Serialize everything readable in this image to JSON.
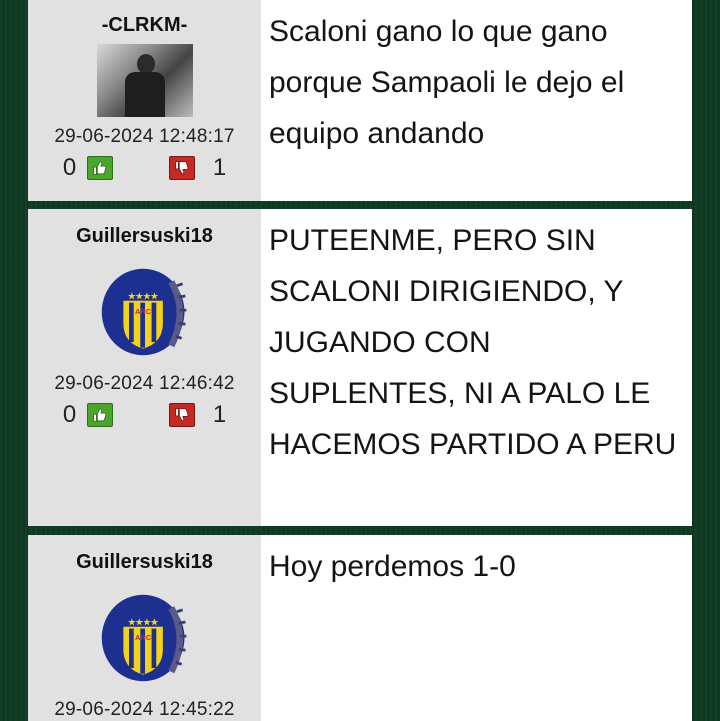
{
  "posts": [
    {
      "username": "-CLRKM-",
      "avatar": "photo-avatar",
      "datetime": "29-06-2024 12:48:17",
      "likes": "0",
      "dislikes": "1",
      "message": "Scaloni gano lo que gano porque Sampaoli le dejo el equipo andando"
    },
    {
      "username": "Guillersuski18",
      "avatar": "rosario-central-crest",
      "datetime": "29-06-2024 12:46:42",
      "likes": "0",
      "dislikes": "1",
      "message": "PUTEENME, PERO SIN SCALONI DIRIGIENDO, Y JUGANDO CON SUPLENTES, NI A PALO LE HACEMOS PARTIDO A PERU"
    },
    {
      "username": "Guillersuski18",
      "avatar": "rosario-central-crest",
      "datetime": "29-06-2024 12:45:22",
      "message": "Hoy perdemos 1-0"
    }
  ],
  "colors": {
    "background": "#0f3a22",
    "user_panel": "#e1e1e1",
    "thumb_up": "#4aa52a",
    "thumb_down": "#c42a25",
    "crest_blue": "#1d2f8f",
    "crest_yellow": "#f2d21b"
  },
  "icons": {
    "like": "thumbs-up-icon",
    "dislike": "thumbs-down-icon"
  }
}
